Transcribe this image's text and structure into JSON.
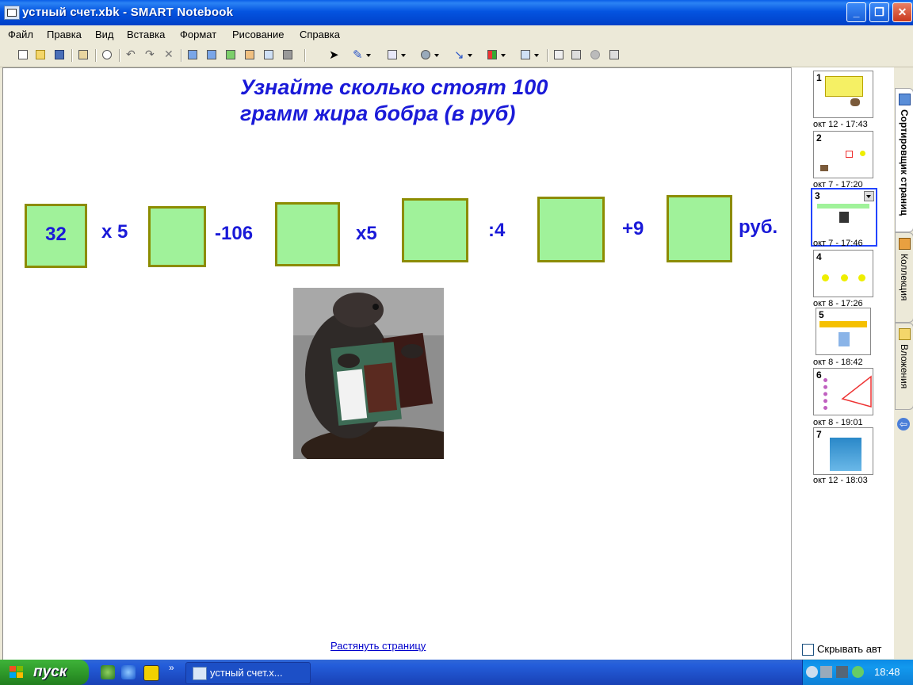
{
  "window": {
    "title": "устный счет.xbk - SMART Notebook"
  },
  "menu": [
    "Файл",
    "Правка",
    "Вид",
    "Вставка",
    "Формат",
    "Рисование",
    "Справка"
  ],
  "slide": {
    "heading": "Узнайте сколько стоят 100 грамм жира бобра (в руб)",
    "boxes": [
      "32",
      "",
      "",
      "",
      "",
      ""
    ],
    "ops": [
      "x 5",
      "-106",
      "x5",
      ":4",
      "+9",
      "руб."
    ],
    "image_label": "beaver-with-accordion"
  },
  "stretch_link": "Растянуть страницу",
  "sorter": {
    "pages": [
      {
        "num": "1",
        "date": "окт 12 - 17:43"
      },
      {
        "num": "2",
        "date": "окт 7 - 17:20"
      },
      {
        "num": "3",
        "date": "окт 7 - 17:46"
      },
      {
        "num": "4",
        "date": "окт 8 - 17:26"
      },
      {
        "num": "5",
        "date": "окт 8 - 18:42"
      },
      {
        "num": "6",
        "date": "окт 8 - 19:01"
      },
      {
        "num": "7",
        "date": "окт 12 - 18:03"
      }
    ],
    "autohide": "Скрывать авт"
  },
  "tabs": {
    "sorter": "Сортировщик страниц",
    "gallery": "Коллекция",
    "attachments": "Вложения"
  },
  "taskbar": {
    "start": "пуск",
    "task": "устный счет.x...",
    "clock": "18:48"
  },
  "colors": {
    "accent_text": "#1a1ad8",
    "box_fill": "#a0f29a",
    "box_border": "#8c8c00"
  }
}
